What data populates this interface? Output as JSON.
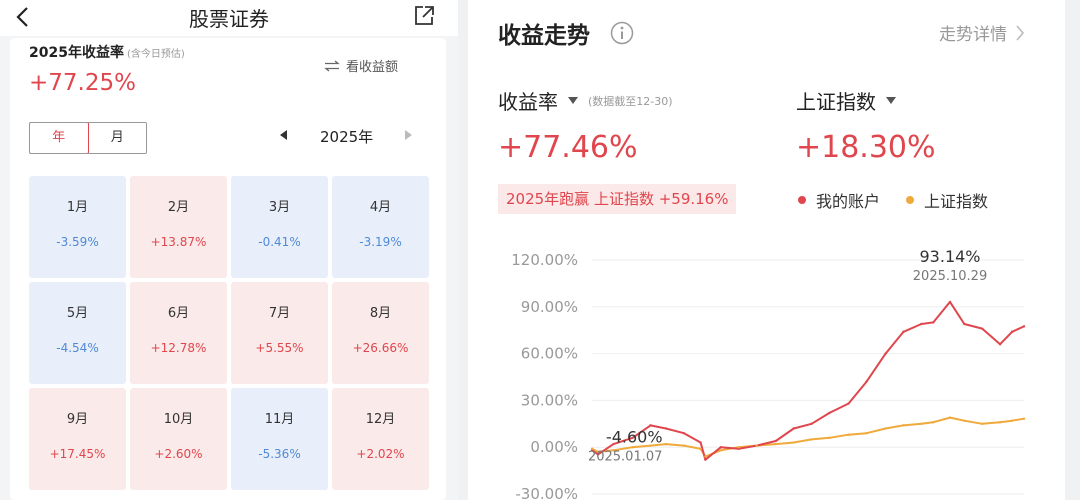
{
  "left": {
    "header_title": "股票证券",
    "year_rate_title": "2025年收益率",
    "year_rate_note": "(含今日预估)",
    "year_rate_value": "+77.25%",
    "toggle_amount_label": "看收益额",
    "period_tabs": [
      "年",
      "月"
    ],
    "year_label": "2025年",
    "months": [
      {
        "month": "1月",
        "value": "-3.59%",
        "sign": "neg"
      },
      {
        "month": "2月",
        "value": "+13.87%",
        "sign": "pos"
      },
      {
        "month": "3月",
        "value": "-0.41%",
        "sign": "neg"
      },
      {
        "month": "4月",
        "value": "-3.19%",
        "sign": "neg"
      },
      {
        "month": "5月",
        "value": "-4.54%",
        "sign": "neg"
      },
      {
        "month": "6月",
        "value": "+12.78%",
        "sign": "pos"
      },
      {
        "month": "7月",
        "value": "+5.55%",
        "sign": "pos"
      },
      {
        "month": "8月",
        "value": "+26.66%",
        "sign": "pos"
      },
      {
        "month": "9月",
        "value": "+17.45%",
        "sign": "pos"
      },
      {
        "month": "10月",
        "value": "+2.60%",
        "sign": "pos"
      },
      {
        "month": "11月",
        "value": "-5.36%",
        "sign": "neg"
      },
      {
        "month": "12月",
        "value": "+2.02%",
        "sign": "pos"
      }
    ]
  },
  "right": {
    "title": "收益走势",
    "detail_link": "走势详情",
    "rate_label": "收益率",
    "rate_note": "(数据截至12-30)",
    "index_label": "上证指数",
    "rate_value": "+77.46%",
    "index_value": "+18.30%",
    "beat_badge": "2025年跑赢 上证指数 +59.16%",
    "legend": [
      {
        "name": "我的账户",
        "color": "#e0464d"
      },
      {
        "name": "上证指数",
        "color": "#f0a93b"
      }
    ]
  },
  "chart_data": {
    "type": "line",
    "yticks": [
      "120.00%",
      "90.00%",
      "60.00%",
      "30.00%",
      "0.00%",
      "-30.00%"
    ],
    "ylim": [
      -30,
      120
    ],
    "x": [
      "2025-01-02",
      "2025-01-07",
      "2025-01-20",
      "2025-02-05",
      "2025-02-20",
      "2025-03-05",
      "2025-03-20",
      "2025-04-03",
      "2025-04-07",
      "2025-04-20",
      "2025-05-05",
      "2025-05-20",
      "2025-06-05",
      "2025-06-20",
      "2025-07-05",
      "2025-07-20",
      "2025-08-05",
      "2025-08-20",
      "2025-09-05",
      "2025-09-20",
      "2025-10-05",
      "2025-10-15",
      "2025-10-29",
      "2025-11-10",
      "2025-11-25",
      "2025-12-10",
      "2025-12-20",
      "2025-12-30"
    ],
    "series": [
      {
        "name": "我的账户",
        "color": "#e0464d",
        "values": [
          -2,
          -4.6,
          2,
          6,
          14,
          12,
          9,
          3,
          -8,
          0,
          -1,
          1,
          4,
          12,
          15,
          22,
          28,
          42,
          60,
          74,
          79,
          80,
          93.14,
          79,
          76,
          66,
          74,
          77.46
        ]
      },
      {
        "name": "上证指数",
        "color": "#f0a93b",
        "values": [
          -1,
          -3,
          -2,
          0,
          1,
          2,
          1,
          -1,
          -6,
          -2,
          0,
          1,
          2,
          3,
          5,
          6,
          8,
          9,
          12,
          14,
          15,
          16,
          19,
          17,
          15,
          16,
          17,
          18.3
        ]
      }
    ],
    "annotations": [
      {
        "label": "-4.60%",
        "date_label": "2025.01.07"
      },
      {
        "label": "93.14%",
        "date_label": "2025.10.29"
      }
    ]
  }
}
